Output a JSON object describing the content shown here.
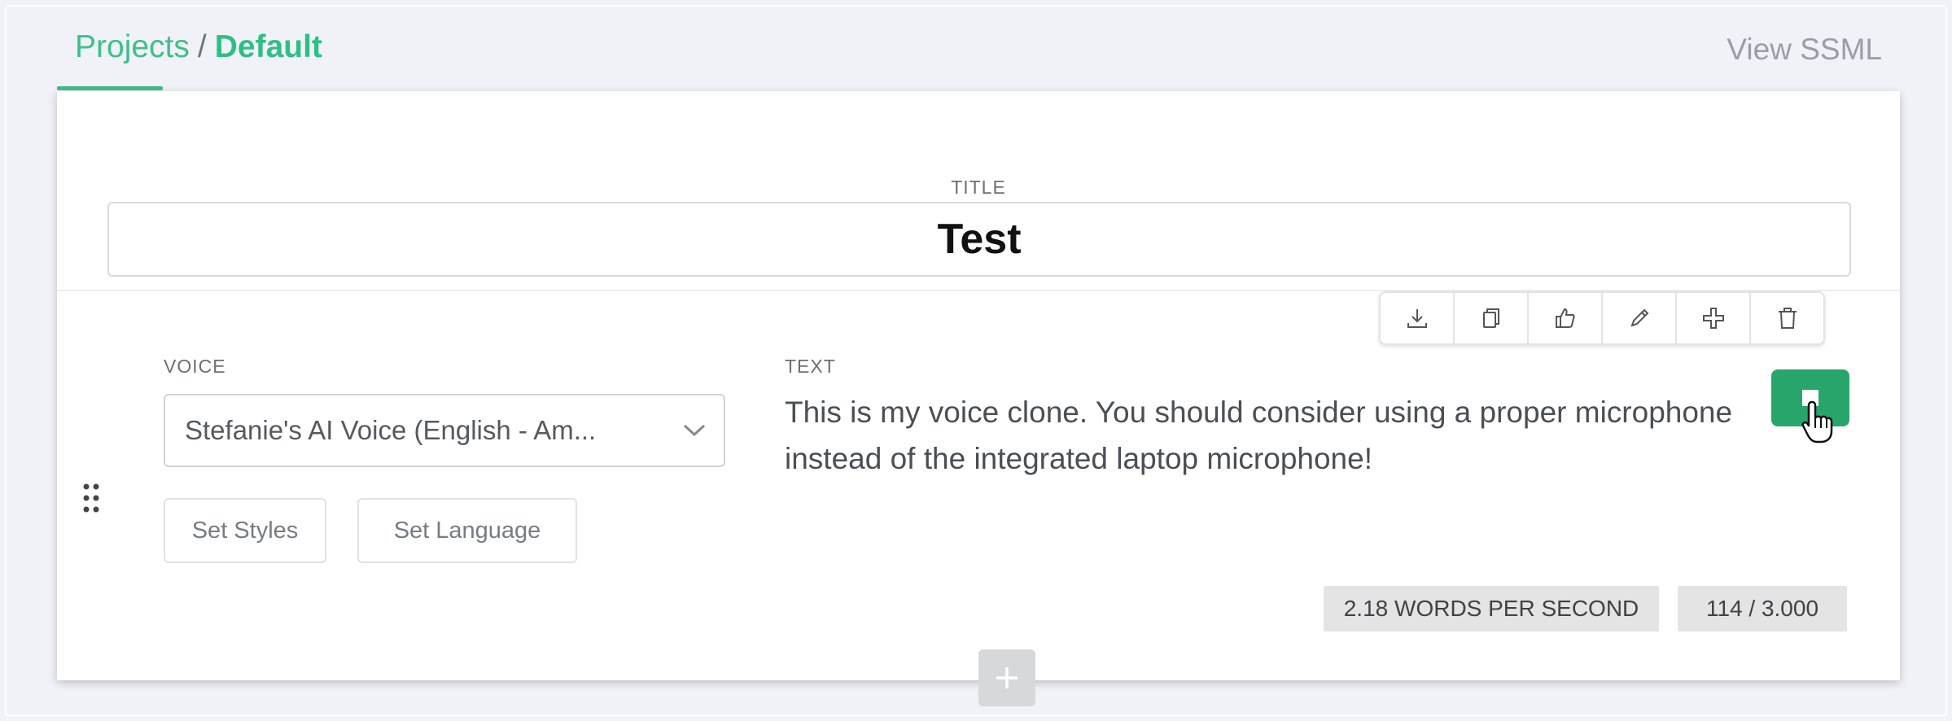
{
  "header": {
    "breadcrumb_parent": "Projects",
    "breadcrumb_separator": "/",
    "breadcrumb_current": "Default",
    "view_ssml": "View SSML"
  },
  "title": {
    "label": "TITLE",
    "value": "Test"
  },
  "toolbar": {
    "icons": [
      "download-icon",
      "copy-icon",
      "thumbs-up-icon",
      "pencil-icon",
      "move-icon",
      "trash-icon"
    ]
  },
  "voice": {
    "label": "VOICE",
    "selected": "Stefanie's AI Voice (English - Am...",
    "set_styles": "Set Styles",
    "set_language": "Set Language"
  },
  "text": {
    "label": "TEXT",
    "content": "This is my voice clone. You should consider using a proper microphone instead of the integrated laptop microphone!",
    "words_per_second": "2.18 WORDS PER SECOND",
    "char_count": "114 / 3.000"
  },
  "colors": {
    "accent": "#3fbf8a",
    "play_button": "#27a56b",
    "badge_bg": "#e4e4e4"
  }
}
